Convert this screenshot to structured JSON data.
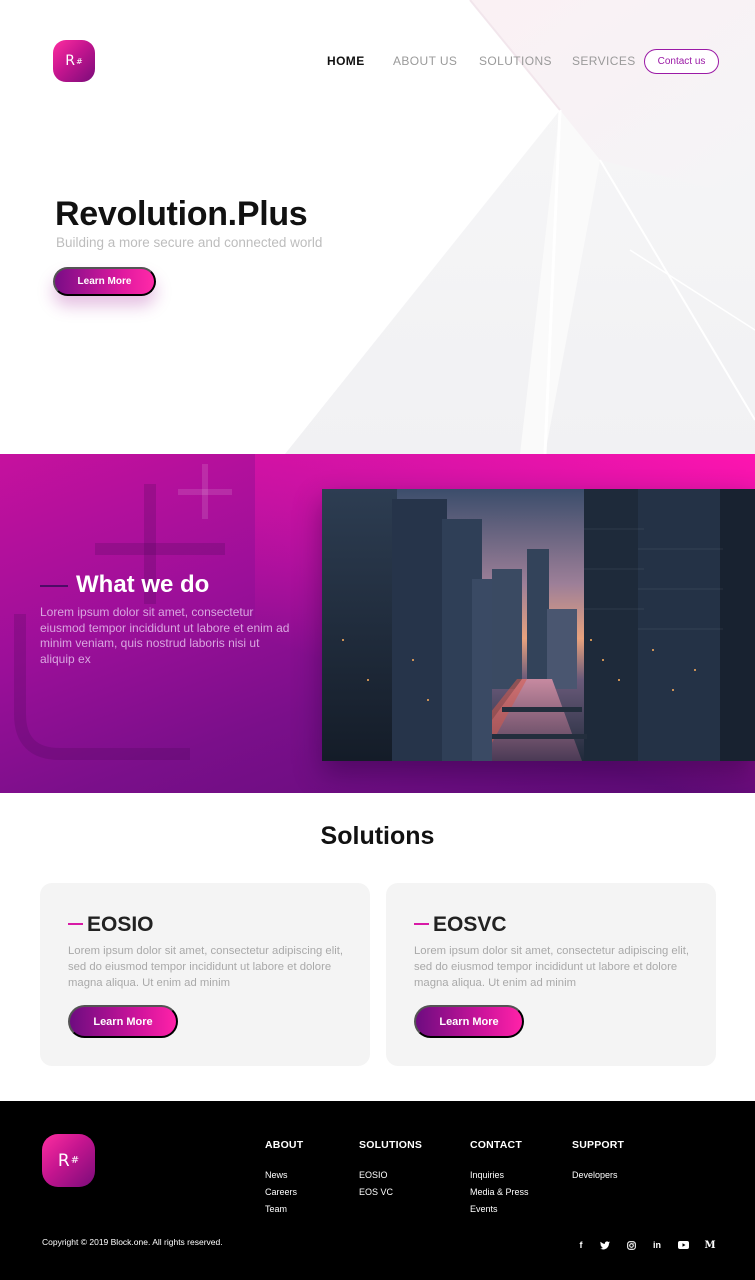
{
  "brand": {
    "logo_text": "R",
    "logo_sup": "#"
  },
  "nav": {
    "items": [
      {
        "label": "HOME"
      },
      {
        "label": "ABOUT US"
      },
      {
        "label": "SOLUTIONS"
      },
      {
        "label": "SERVICES"
      }
    ],
    "contact_label": "Contact us"
  },
  "hero": {
    "title_main": "Revolution.",
    "title_bold": "Plus",
    "subtitle": "Building a more secure and connected world",
    "cta_label": "Learn More"
  },
  "what_we_do": {
    "title": "What we do",
    "text": "Lorem ipsum dolor sit amet, consectetur eiusmod tempor incididunt ut labore et enim ad minim veniam, quis nostrud laboris nisi ut aliquip ex"
  },
  "solutions": {
    "title": "Solutions",
    "cards": [
      {
        "title": "EOSIO",
        "text": "Lorem ipsum dolor sit amet, consectetur adipiscing elit, sed do eiusmod tempor incididunt ut labore et dolore magna aliqua. Ut enim ad minim",
        "button": "Learn More"
      },
      {
        "title": "EOSVC",
        "text": "Lorem ipsum dolor sit amet, consectetur adipiscing elit, sed do eiusmod tempor incididunt ut labore et dolore magna aliqua. Ut enim ad minim",
        "button": "Learn More"
      }
    ]
  },
  "footer": {
    "columns": [
      {
        "heading": "ABOUT",
        "links": [
          "News",
          "Careers",
          "Team"
        ]
      },
      {
        "heading": "SOLUTIONS",
        "links": [
          "EOSIO",
          "EOS VC"
        ]
      },
      {
        "heading": "CONTACT",
        "links": [
          "Inquiries",
          "Media & Press",
          "Events"
        ]
      },
      {
        "heading": "SUPPORT",
        "links": [
          "Developers"
        ]
      }
    ],
    "copyright": "Copyright © 2019 Block.one. All rights reserved.",
    "socials": [
      {
        "icon": "facebook-icon",
        "glyph": "f"
      },
      {
        "icon": "twitter-icon",
        "glyph": ""
      },
      {
        "icon": "instagram-icon",
        "glyph": ""
      },
      {
        "icon": "linkedin-icon",
        "glyph": "in"
      },
      {
        "icon": "youtube-icon",
        "glyph": ""
      },
      {
        "icon": "medium-icon",
        "glyph": "M"
      }
    ]
  },
  "colors": {
    "accent": "#d81aa6",
    "accent_dark": "#7a0d86",
    "footer_bg": "#000000"
  }
}
